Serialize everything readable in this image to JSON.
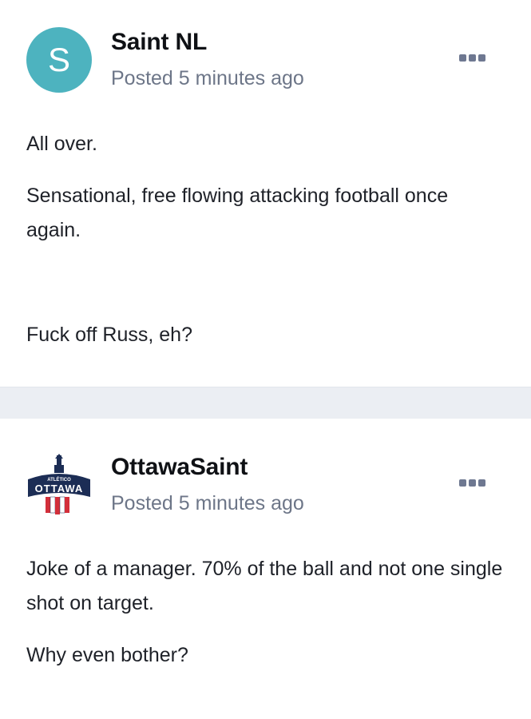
{
  "posts": [
    {
      "author": "Saint NL",
      "avatar_letter": "S",
      "avatar_color": "#4db3bf",
      "posted": "Posted 5 minutes ago",
      "paragraphs": [
        "All over.",
        "Sensational, free flowing attacking football once again.",
        "Fuck off Russ, eh?"
      ]
    },
    {
      "author": "OttawaSaint",
      "avatar_logo_text_top": "ATLÉTICO",
      "avatar_logo_text_main": "OTTAWA",
      "posted": "Posted 5 minutes ago",
      "paragraphs": [
        "Joke of a manager. 70% of the ball and not one single shot on target.",
        "Why even bother?"
      ]
    }
  ],
  "icons": {
    "menu": "more-options-icon"
  },
  "colors": {
    "separator": "#ebeef3",
    "meta_text": "#6d7688",
    "menu_dots": "#6e7891",
    "logo_navy": "#1c2d55",
    "logo_red": "#d32f3a"
  }
}
